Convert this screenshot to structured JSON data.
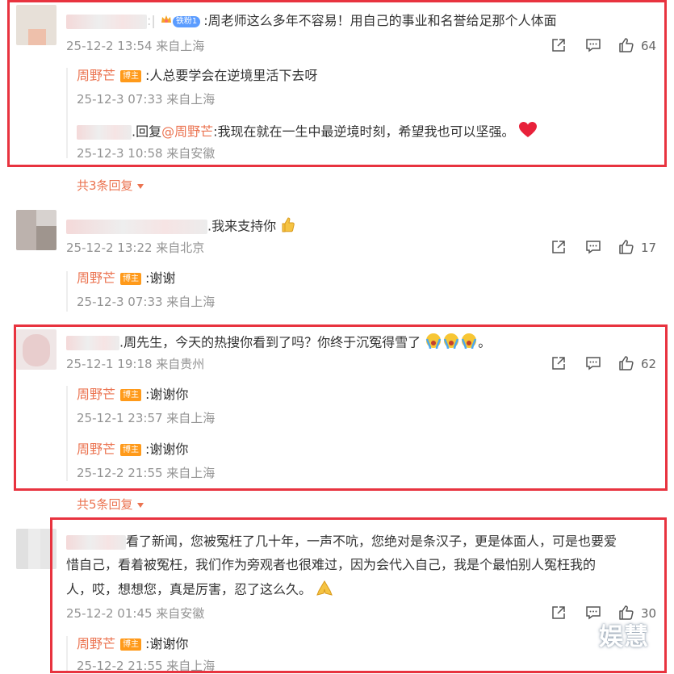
{
  "comments": [
    {
      "text": ":周老师这么多年不容易！用自己的事业和名誉给足那个人体面",
      "fan_badge": "铁粉1",
      "time": "25-12-2 13:54 来自上海",
      "likes": "64",
      "replies": [
        {
          "name": "周野芒",
          "badge": "博主",
          "text": ":人总要学会在逆境里活下去呀",
          "time": "25-12-3 07:33 来自上海"
        },
        {
          "prefix": ".回复",
          "mention": "@周野芒",
          "text": ":我现在就在一生中最逆境时刻，希望我也可以坚强。",
          "time": "25-12-3 10:58 来自安徽"
        }
      ],
      "more": "共3条回复"
    },
    {
      "text": ".我来支持你",
      "time": "25-12-2 13:22 来自北京",
      "likes": "17",
      "replies": [
        {
          "name": "周野芒",
          "badge": "博主",
          "text": ":谢谢",
          "time": "25-12-3 07:33 来自上海"
        }
      ]
    },
    {
      "text": ".周先生，今天的热搜你看到了吗？你终于沉冤得雪了",
      "text_end": "。",
      "time": "25-12-1 19:18 来自贵州",
      "likes": "62",
      "replies": [
        {
          "name": "周野芒",
          "badge": "博主",
          "text": ":谢谢你",
          "time": "25-12-1 23:57 来自上海"
        },
        {
          "name": "周野芒",
          "badge": "博主",
          "text": ":谢谢你",
          "time": "25-12-2 21:55 来自上海"
        }
      ],
      "more": "共5条回复"
    },
    {
      "lines": [
        "看了新闻，您被冤枉了几十年，一声不吭，您绝对是条汉子，更是体面人，可是也要爱",
        "惜自己，看着被冤枉，我们作为旁观者也很难过，因为会代入自己，我是个最怕别人冤枉我的",
        "人，哎，想想您，真是厉害，忍了这么久。"
      ],
      "time": "25-12-2 01:45 来自安徽",
      "likes": "30",
      "replies": [
        {
          "name": "周野芒",
          "badge": "博主",
          "text": ":谢谢你",
          "time": "25-12-2 21:55 来自上海"
        }
      ]
    }
  ],
  "watermark": "娱慧",
  "colors": {
    "accent": "#eb7350",
    "frame": "#e8333f",
    "meta": "#939393",
    "badge": "#ff9a1a"
  },
  "icons": [
    "share-icon",
    "comment-icon",
    "like-icon",
    "chevron-down-icon",
    "heart-emoji",
    "thumbs-up-emoji",
    "crying-emoji",
    "pray-emoji"
  ]
}
